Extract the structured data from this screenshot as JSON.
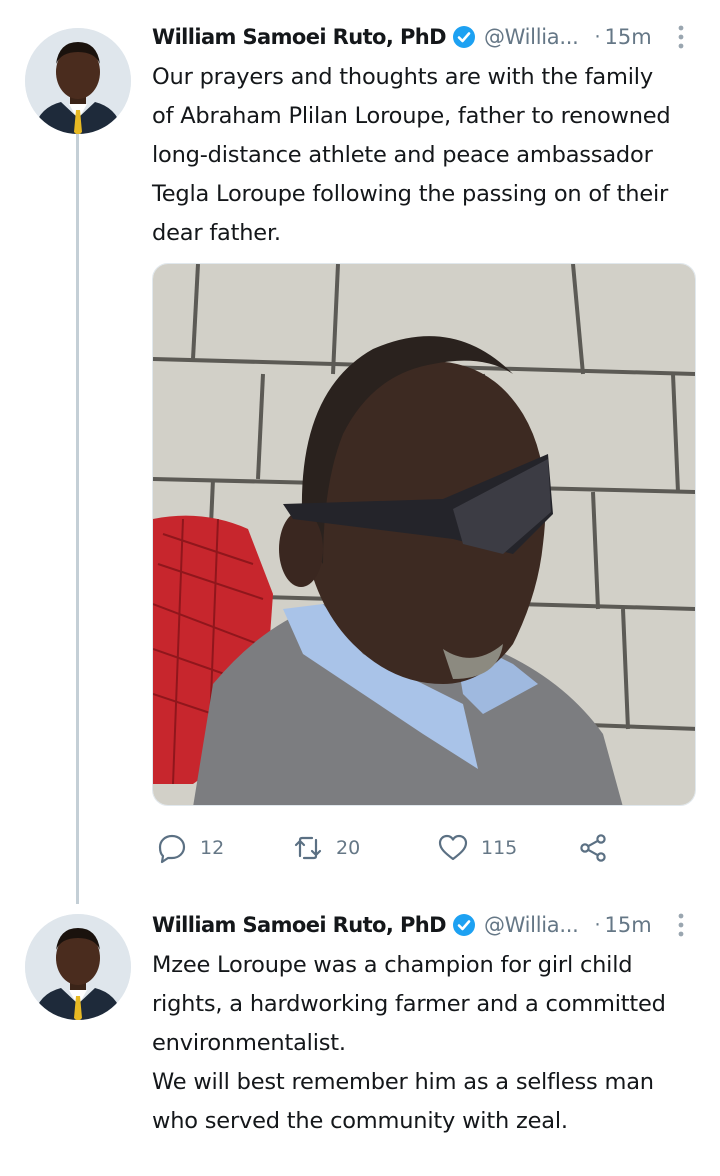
{
  "tweets": [
    {
      "author_name": "William Samoei Ruto, PhD",
      "handle": "@Willia...",
      "separator": "·",
      "time": "15m",
      "text": "Our prayers and thoughts are with the family\nof Abraham Plilan Loroupe, father to renowned\nlong-distance athlete and peace ambassador\nTegla Loroupe following the passing on of their\ndear father.",
      "actions": {
        "reply_count": "12",
        "retweet_count": "20",
        "like_count": "115"
      }
    },
    {
      "author_name": "William Samoei Ruto, PhD",
      "handle": "@Willia...",
      "separator": "·",
      "time": "15m",
      "text": "Mzee Loroupe was a champion for girl child\nrights, a hardworking farmer and a committed\nenvironmentalist.\nWe will best remember him as a selfless man\nwho served the community with zeal."
    }
  ],
  "icons": {
    "verified": "verified-badge-icon",
    "more": "more-vertical-icon",
    "reply": "reply-icon",
    "retweet": "retweet-icon",
    "like": "heart-icon",
    "share": "share-icon"
  },
  "colors": {
    "accent": "#1da1f2",
    "text": "#14171a",
    "secondary": "#657786",
    "thread_line": "#c4cfd6"
  }
}
